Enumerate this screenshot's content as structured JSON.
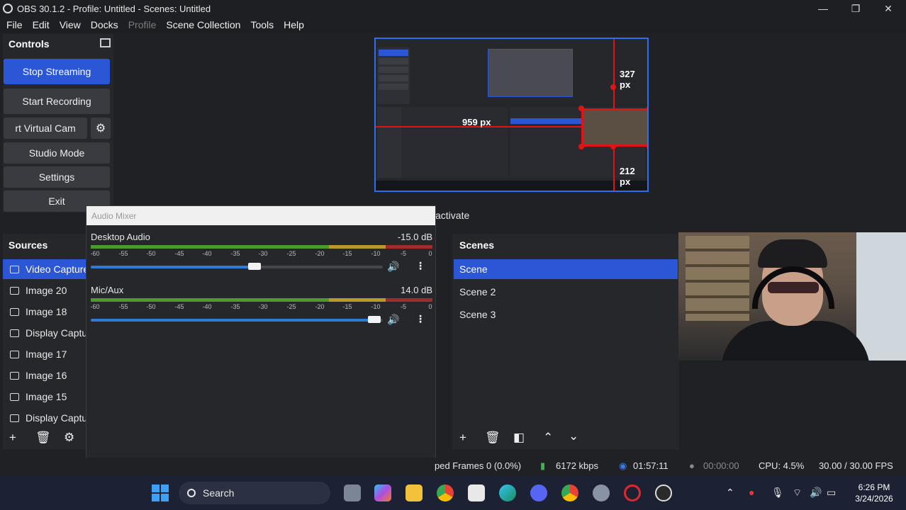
{
  "window": {
    "title": "OBS 30.1.2 - Profile: Untitled - Scenes: Untitled",
    "minimize": "—",
    "maximize": "❐",
    "close": "✕"
  },
  "menu": [
    "File",
    "Edit",
    "View",
    "Docks",
    "Profile",
    "Scene Collection",
    "Tools",
    "Help"
  ],
  "controls": {
    "title": "Controls",
    "stop_streaming": "Stop Streaming",
    "start_recording": "Start Recording",
    "virtual_cam": "rt Virtual Cam",
    "studio_mode": "Studio Mode",
    "settings": "Settings",
    "exit": "Exit"
  },
  "preview": {
    "width_label": "959 px",
    "top_label": "327 px",
    "bottom_label": "212 px",
    "behind_text": "activate"
  },
  "audio_mixer": {
    "title": "Audio Mixer",
    "scale": [
      "-60",
      "-55",
      "-50",
      "-45",
      "-40",
      "-35",
      "-30",
      "-25",
      "-20",
      "-15",
      "-10",
      "-5",
      "0"
    ],
    "channels": [
      {
        "name": "Desktop Audio",
        "db": "-15.0 dB",
        "volume": 0.56
      },
      {
        "name": "Mic/Aux",
        "db": "14.0 dB",
        "volume": 0.97
      }
    ]
  },
  "sources": {
    "title": "Sources",
    "items": [
      {
        "label": "Video Capture",
        "selected": true
      },
      {
        "label": "Image 20",
        "selected": false
      },
      {
        "label": "Image 18",
        "selected": false
      },
      {
        "label": "Display Captu",
        "selected": false
      },
      {
        "label": "Image 17",
        "selected": false
      },
      {
        "label": "Image 16",
        "selected": false
      },
      {
        "label": "Image 15",
        "selected": false
      },
      {
        "label": "Display Captu",
        "selected": false
      }
    ]
  },
  "scenes": {
    "title": "Scenes",
    "items": [
      {
        "label": "Scene",
        "selected": true
      },
      {
        "label": "Scene 2",
        "selected": false
      },
      {
        "label": "Scene 3",
        "selected": false
      }
    ]
  },
  "status": {
    "dropped_frames": "ped Frames 0 (0.0%)",
    "bitrate": "6172 kbps",
    "stream_time": "01:57:11",
    "record_time": "00:00:00",
    "cpu": "CPU: 4.5%",
    "fps": "30.00 / 30.00 FPS"
  },
  "taskbar": {
    "search_label": "Search",
    "time": "6:26 PM",
    "date": "3/24/2026"
  },
  "colors": {
    "accent": "#2b56d6",
    "selection_red": "#e01414"
  }
}
